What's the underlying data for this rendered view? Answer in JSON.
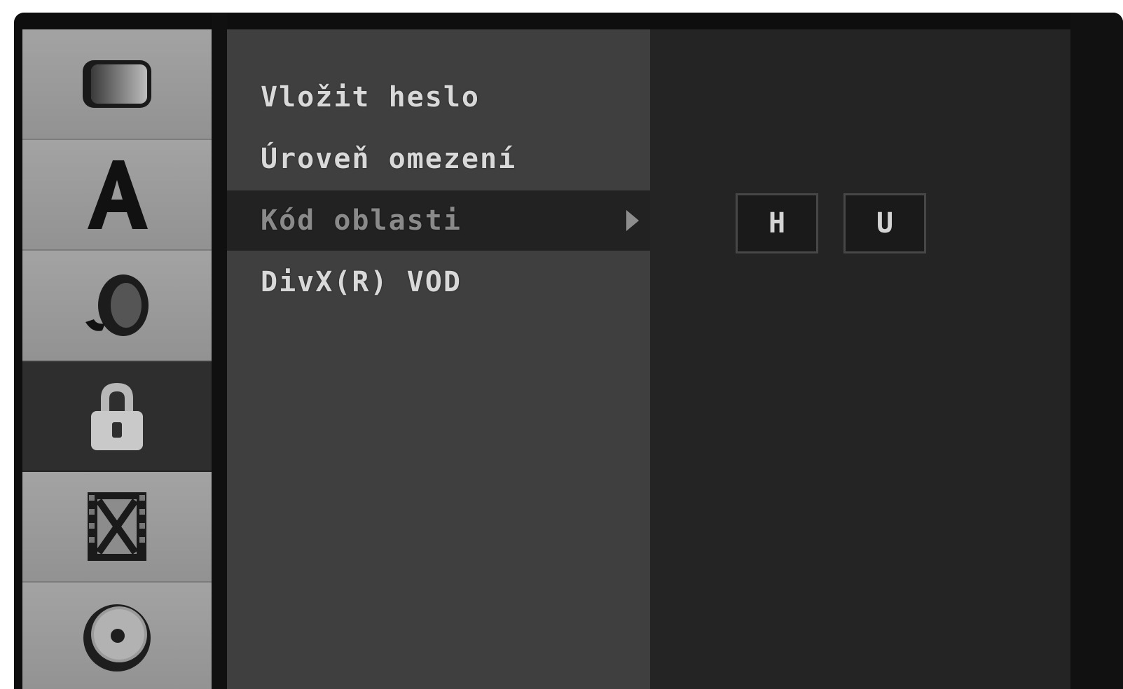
{
  "sidebar": {
    "items": [
      {
        "icon": "tv-screen-icon",
        "active": false
      },
      {
        "icon": "language-letter-icon",
        "active": false
      },
      {
        "icon": "speaker-audio-icon",
        "active": false
      },
      {
        "icon": "lock-icon",
        "active": true
      },
      {
        "icon": "film-recording-icon",
        "active": false
      },
      {
        "icon": "disc-icon",
        "active": false
      }
    ]
  },
  "menu": {
    "items": [
      {
        "label": "Vložit heslo"
      },
      {
        "label": "Úroveň omezení"
      },
      {
        "label": "Kód oblasti",
        "selected": true
      },
      {
        "label": "DivX(R) VOD"
      }
    ]
  },
  "region_code": {
    "chars": [
      "H",
      "U"
    ]
  },
  "colors": {
    "sidebar": "#9a9a9a",
    "sidebar_active": "#2e2e2e",
    "menu_bg": "#3f3f3f",
    "menu_selected": "#222222",
    "panel_bg": "#242424"
  }
}
